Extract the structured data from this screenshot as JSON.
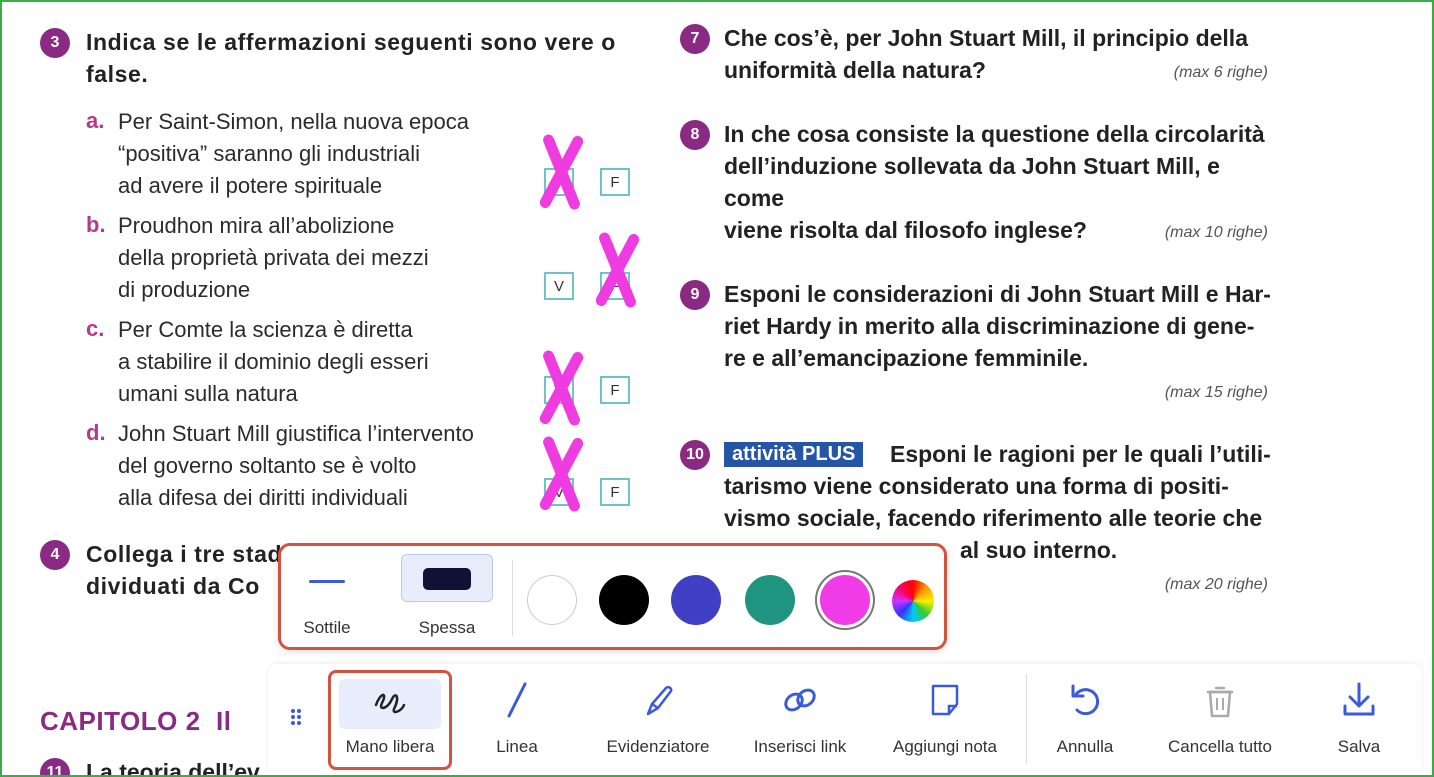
{
  "page": {
    "q3": {
      "number": "3",
      "text": "Indica se le affermazioni seguenti sono vere o\nfalse.",
      "items": [
        {
          "letter": "a.",
          "text": "Per Saint-Simon, nella nuova epoca\n“positiva” saranno gli industriali\nad avere il potere spirituale",
          "answer": "V",
          "other": "F"
        },
        {
          "letter": "b.",
          "text": "Proudhon mira all’abolizione\ndella proprietà privata dei mezzi\ndi produzione",
          "answer": "F",
          "other": "V"
        },
        {
          "letter": "c.",
          "text": "Per Comte la scienza è diretta\na stabilire il dominio degli esseri\numani sulla natura",
          "answer": "V",
          "other": "F"
        },
        {
          "letter": "d.",
          "text": "John Stuart Mill giustifica l’intervento\ndel governo soltanto se è volto\nalla difesa dei diritti individuali",
          "answer": "V",
          "other": "F"
        }
      ]
    },
    "q4": {
      "number": "4",
      "line1": "Collega i tre stad",
      "line2": "dividuati da Co"
    },
    "q7": {
      "number": "7",
      "text": "Che cos’è, per John Stuart Mill, il principio della\nuniformità della natura?",
      "max": "(max 6 righe)"
    },
    "q8": {
      "number": "8",
      "text": "In che cosa consiste la questione della circolarità\ndell’induzione sollevata da John Stuart Mill, e come\nviene risolta dal filosofo inglese?",
      "max": "(max 10 righe)"
    },
    "q9": {
      "number": "9",
      "text": "Esponi le considerazioni di John Stuart Mill e Har-\nriet Hardy in merito alla discriminazione di gene-\nre e all’emancipazione femminile.",
      "max": "(max 15 righe)"
    },
    "q10": {
      "number": "10",
      "tag": "attività PLUS",
      "line1": "Esponi le ragioni per le quali l’utili-",
      "rest": "tarismo viene considerato una forma di positi-\nvismo sociale, facendo riferimento alle teorie che",
      "line4": "al suo interno.",
      "max": "(max 20 righe)"
    },
    "chapter": "CAPITOLO 2  Il",
    "q11": {
      "number": "11",
      "text": "La teoria dell’ev"
    }
  },
  "popup": {
    "thickness": [
      {
        "label": "Sottile",
        "selected": false
      },
      {
        "label": "Spessa",
        "selected": true
      }
    ],
    "colors": [
      {
        "name": "white",
        "hex": "#ffffff",
        "selected": false
      },
      {
        "name": "black",
        "hex": "#000000",
        "selected": false
      },
      {
        "name": "blue",
        "hex": "#3f3fc4",
        "selected": false
      },
      {
        "name": "teal",
        "hex": "#1f9480",
        "selected": false
      },
      {
        "name": "magenta",
        "hex": "#f03ce6",
        "selected": true
      },
      {
        "name": "custom",
        "hex": "conic",
        "selected": false
      }
    ]
  },
  "toolbar": {
    "tools": [
      {
        "id": "freehand",
        "label": "Mano libera",
        "icon": "freehand-icon",
        "selected": true
      },
      {
        "id": "line",
        "label": "Linea",
        "icon": "line-icon",
        "selected": false
      },
      {
        "id": "highlighter",
        "label": "Evidenziatore",
        "icon": "highlighter-icon",
        "selected": false
      },
      {
        "id": "link",
        "label": "Inserisci link",
        "icon": "link-icon",
        "selected": false
      },
      {
        "id": "note",
        "label": "Aggiungi nota",
        "icon": "note-icon",
        "selected": false
      },
      {
        "id": "undo",
        "label": "Annulla",
        "icon": "undo-icon",
        "selected": false
      },
      {
        "id": "clear",
        "label": "Cancella tutto",
        "icon": "trash-icon",
        "selected": false
      },
      {
        "id": "save",
        "label": "Salva",
        "icon": "download-icon",
        "selected": false
      }
    ]
  },
  "colors": {
    "accent": "#3b5bd9",
    "purple": "#8a2a82",
    "highlight_border": "#d4533e",
    "frame": "#3cab4a"
  }
}
